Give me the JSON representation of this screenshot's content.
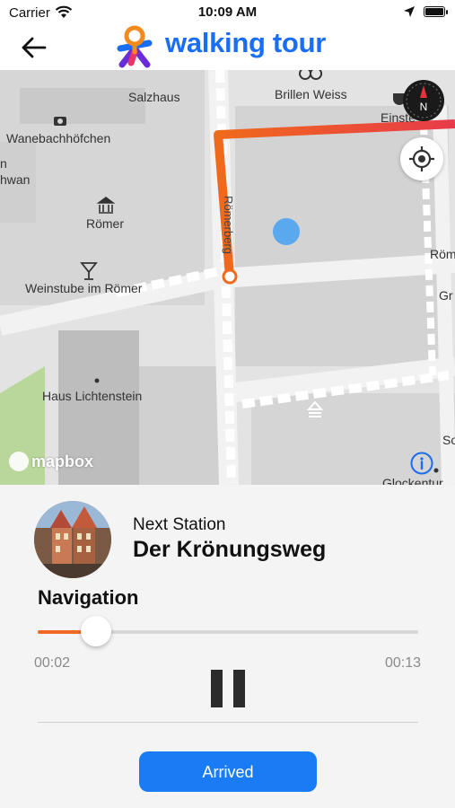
{
  "status_bar": {
    "carrier": "Carrier",
    "time": "10:09 AM"
  },
  "header": {
    "brand": "walking tour",
    "back_icon": "arrow-left-icon",
    "logo_icon": "walking-tour-logo"
  },
  "map": {
    "labels": {
      "salzhaus": "Salzhaus",
      "brillen_weiss": "Brillen Weiss",
      "einstein": "Einste",
      "wanebach": "Wanebachhöfchen",
      "n_cut": "n",
      "hwan_cut": "hwan",
      "romer": "Römer",
      "romer_right_cut": "Röm",
      "gr_cut": "Gr",
      "weinstube": "Weinstube im Römer",
      "haus_lichtenstein": "Haus Lichtenstein",
      "so_cut": "So",
      "glockenturm_cut": "Glockentur",
      "street_romerberg": "Römerberg",
      "compass_letter": "N"
    },
    "attribution": "mapbox",
    "colors": {
      "route_start": "#f06a1b",
      "route_end": "#e83a4a",
      "location_dot": "#5aa9ee",
      "park": "#b9d79a"
    }
  },
  "player": {
    "next_label": "Next Station",
    "station_name": "Der Krönungsweg",
    "section_title": "Navigation",
    "elapsed": "00:02",
    "total": "00:13",
    "progress_fraction": 0.154,
    "accent_color": "#f26a28",
    "arrived_label": "Arrived"
  }
}
